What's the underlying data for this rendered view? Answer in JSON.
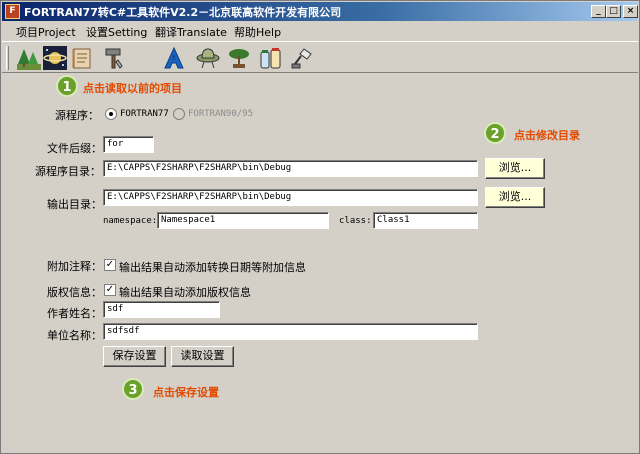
{
  "window": {
    "title": "FORTRAN77转C#工具软件V2.2－北京联高软件开发有限公司",
    "icon_text": "F"
  },
  "window_buttons": {
    "minimize": "_",
    "maximize": "□",
    "close": "×"
  },
  "menu": [
    "项目Project",
    "设置Setting",
    "翻译Translate",
    "帮助Help"
  ],
  "toolbar": {
    "icons": [
      "tree-icon",
      "saturn-icon",
      "book-icon",
      "hammer-icon",
      "a-letter-icon",
      "hat-icon",
      "bonsai-icon",
      "jars-icon",
      "lamp-icon"
    ]
  },
  "callouts": {
    "step1": {
      "num": "1",
      "text": "点击读取以前的项目"
    },
    "step2": {
      "num": "2",
      "text": "点击修改目录"
    },
    "step3": {
      "num": "3",
      "text": "点击保存设置"
    }
  },
  "form": {
    "source_label": "源程序：",
    "radio_f77": "FORTRAN77",
    "radio_f90": "FORTRAN90/95",
    "suffix_label": "文件后缀：",
    "suffix_value": "for",
    "src_dir_label": "源程序目录：",
    "src_dir_value": "E:\\CAPPS\\F2SHARP\\F2SHARP\\bin\\Debug",
    "browse_label": "浏览...",
    "out_dir_label": "输出目录：",
    "out_dir_value": "E:\\CAPPS\\F2SHARP\\F2SHARP\\bin\\Debug",
    "namespace_label": "namespace:",
    "namespace_value": "Namespace1",
    "class_label": "class:",
    "class_value": "Class1",
    "annot_label": "附加注释：",
    "annot_check_label": "输出结果自动添加转换日期等附加信息",
    "copyright_label": "版权信息：",
    "copyright_check_label": "输出结果自动添加版权信息",
    "author_label": "作者姓名：",
    "author_value": "sdf",
    "org_label": "单位名称：",
    "org_value": "sdfsdf",
    "save_btn": "保存设置",
    "load_btn": "读取设置"
  },
  "colors": {
    "accent_green": "#6aa12a",
    "callout_orange": "#e24b00",
    "title_blue": "#0a246a"
  }
}
